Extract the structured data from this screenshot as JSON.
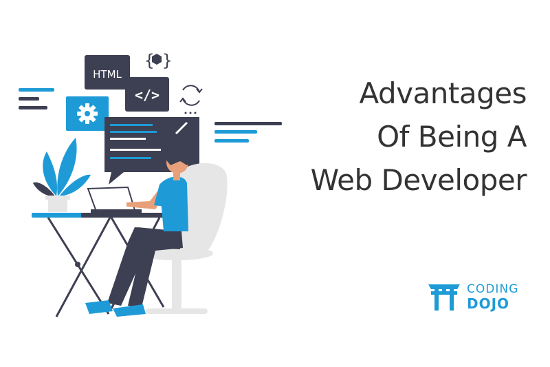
{
  "headline": {
    "line1": "Advantages",
    "line2": "Of Being A",
    "line3": "Web Developer"
  },
  "illustration": {
    "html_badge": "HTML",
    "code_badge": "</>",
    "braces_badge": "{ }"
  },
  "brand": {
    "word1": "CODING",
    "word2": "DOJO",
    "logo_icon": "torii-gate-icon"
  },
  "colors": {
    "accent": "#1e9bd7",
    "dark": "#3d3f52",
    "text": "#333333",
    "skin": "#e8a07a",
    "chair": "#e6e6e6"
  }
}
